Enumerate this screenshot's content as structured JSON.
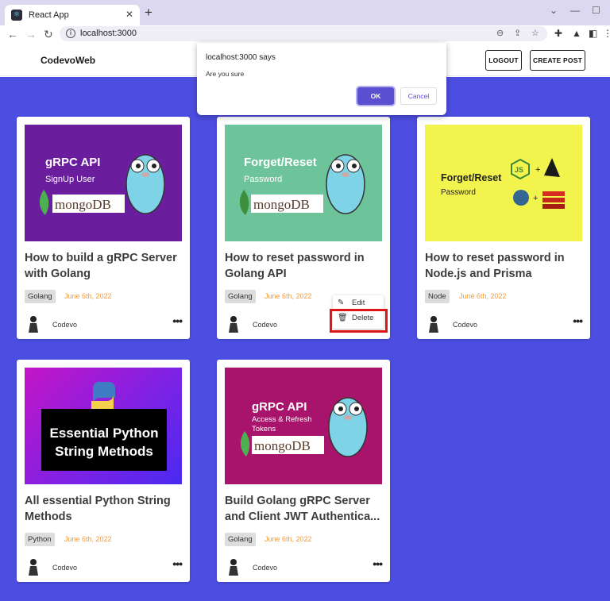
{
  "browser": {
    "tab_title": "React App",
    "tab_close": "✕",
    "new_tab": "+",
    "url": "localhost:3000",
    "minimize": "—",
    "maximize": "☐"
  },
  "header": {
    "brand": "CodevoWeb",
    "logout_label": "LOGOUT",
    "create_post_label": "CREATE POST"
  },
  "dialog": {
    "title": "localhost:3000 says",
    "message": "Are you sure",
    "ok_label": "OK",
    "cancel_label": "Cancel"
  },
  "context_menu": {
    "edit_label": "Edit",
    "delete_label": "Delete"
  },
  "posts": [
    {
      "title_line1": "How to build a gRPC Server",
      "title_line2": "with Golang",
      "tag": "Golang",
      "date": "June 6th, 2022",
      "author": "Codevo",
      "thumb": {
        "line1": "gRPC API",
        "line2": "SignUp User",
        "logo": "mongoDB"
      }
    },
    {
      "title_line1": "How to reset password in",
      "title_line2": "Golang API",
      "tag": "Golang",
      "date": "June 6th, 2022",
      "author": "Codevo",
      "thumb": {
        "line1": "Forget/Reset",
        "line2": "Password",
        "logo": "mongoDB"
      }
    },
    {
      "title_line1": "How to reset password in",
      "title_line2": "Node.js and Prisma",
      "tag": "Node",
      "date": "June 6th, 2022",
      "author": "Codevo",
      "thumb": {
        "line1": "Forget/Reset",
        "line2": "Password",
        "js": "JS"
      }
    },
    {
      "title_line1": "All essential Python String",
      "title_line2": "Methods",
      "tag": "Python",
      "date": "June 6th, 2022",
      "author": "Codevo",
      "thumb": {
        "line1": "Essential Python",
        "line2": "String Methods"
      }
    },
    {
      "title_line1": "Build Golang gRPC Server",
      "title_line2": "and Client JWT Authentica...",
      "tag": "Golang",
      "date": "June 6th, 2022",
      "author": "Codevo",
      "thumb": {
        "line1": "gRPC API",
        "line2": "Access & Refresh",
        "line3": "Tokens",
        "logo": "mongoDB"
      }
    }
  ],
  "colors": {
    "main_bg": "#4c4ee2",
    "date": "#f39c3f",
    "highlight": "#e01616",
    "dialog_ok": "#5a4fd1"
  }
}
